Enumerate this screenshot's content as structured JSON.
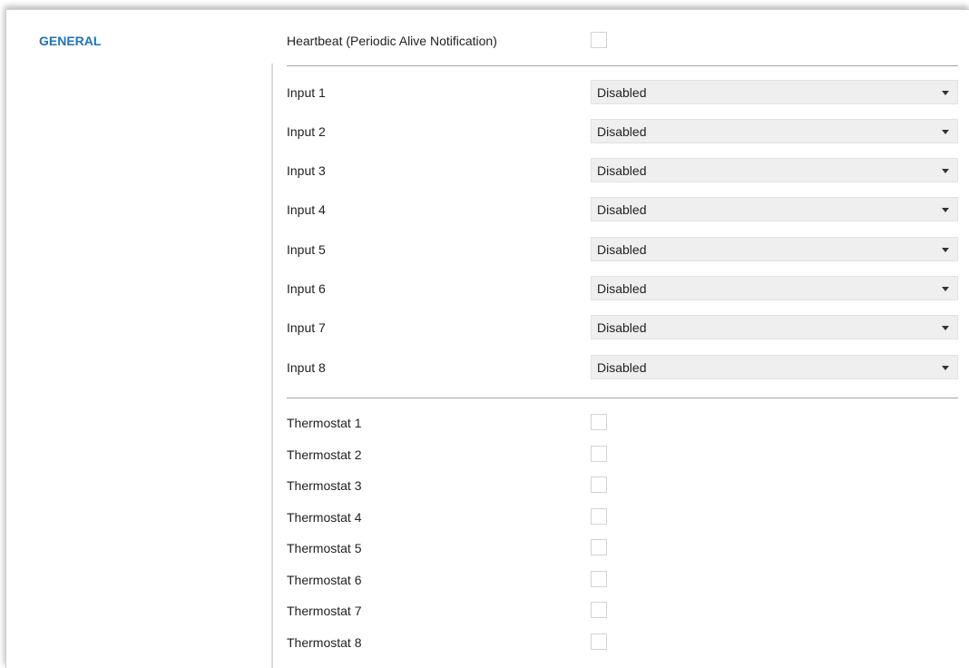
{
  "sidebar": {
    "items": [
      {
        "label": "GENERAL"
      }
    ]
  },
  "heartbeat": {
    "label": "Heartbeat (Periodic Alive Notification)",
    "checked": false
  },
  "inputs": [
    {
      "label": "Input 1",
      "value": "Disabled"
    },
    {
      "label": "Input 2",
      "value": "Disabled"
    },
    {
      "label": "Input 3",
      "value": "Disabled"
    },
    {
      "label": "Input 4",
      "value": "Disabled"
    },
    {
      "label": "Input 5",
      "value": "Disabled"
    },
    {
      "label": "Input 6",
      "value": "Disabled"
    },
    {
      "label": "Input 7",
      "value": "Disabled"
    },
    {
      "label": "Input 8",
      "value": "Disabled"
    }
  ],
  "thermostats": [
    {
      "label": "Thermostat 1",
      "checked": false
    },
    {
      "label": "Thermostat 2",
      "checked": false
    },
    {
      "label": "Thermostat 3",
      "checked": false
    },
    {
      "label": "Thermostat 4",
      "checked": false
    },
    {
      "label": "Thermostat 5",
      "checked": false
    },
    {
      "label": "Thermostat 6",
      "checked": false
    },
    {
      "label": "Thermostat 7",
      "checked": false
    },
    {
      "label": "Thermostat 8",
      "checked": false
    }
  ],
  "colors": {
    "accent": "#1e73be",
    "select_bg": "#efefef",
    "separator": "#a6a6a6"
  }
}
